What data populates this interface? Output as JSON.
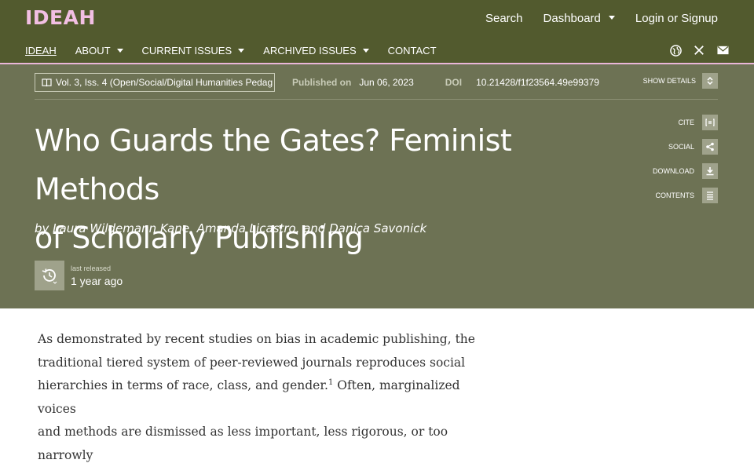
{
  "brand": "IDEAH",
  "top_links": {
    "search": "Search",
    "dashboard": "Dashboard",
    "login": "Login or Signup"
  },
  "nav": {
    "home": "IDEAH",
    "about": "ABOUT",
    "current": "CURRENT ISSUES",
    "archived": "ARCHIVED ISSUES",
    "contact": "CONTACT"
  },
  "meta": {
    "issue": "Vol. 3, Iss. 4 (Open/Social/Digital Humanities Pedag",
    "published_label": "Published on",
    "published_date": "Jun 06, 2023",
    "doi_label": "DOI",
    "doi_value": "10.21428/f1f23564.49e99379",
    "show_details": "SHOW DETAILS"
  },
  "title_line1": "Who Guards the Gates? Feminist Methods",
  "title_line2": "of Scholarly Publishing",
  "byline": "by Laura Wildemann Kane, Amanda Licastro, and Danica Savonick",
  "actions": {
    "cite": "CITE",
    "social": "SOCIAL",
    "download": "DOWNLOAD",
    "contents": "CONTENTS"
  },
  "release": {
    "label": "last released",
    "value": "1 year ago"
  },
  "body": {
    "line1": "As demonstrated by recent studies on bias in academic publishing, the",
    "line2": "traditional tiered system of peer-reviewed journals reproduces social",
    "line3a": "hierarchies in terms of race, class, and gender.",
    "footnote": "1",
    "line3b": " Often, marginalized voices",
    "line4": "and methods are dismissed as less important, less rigorous, or too narrowly"
  },
  "colors": {
    "header": "#525a2e",
    "hero": "#6d7254",
    "brand": "#f2bfe3",
    "accent_rule": "#e9b6d9"
  }
}
